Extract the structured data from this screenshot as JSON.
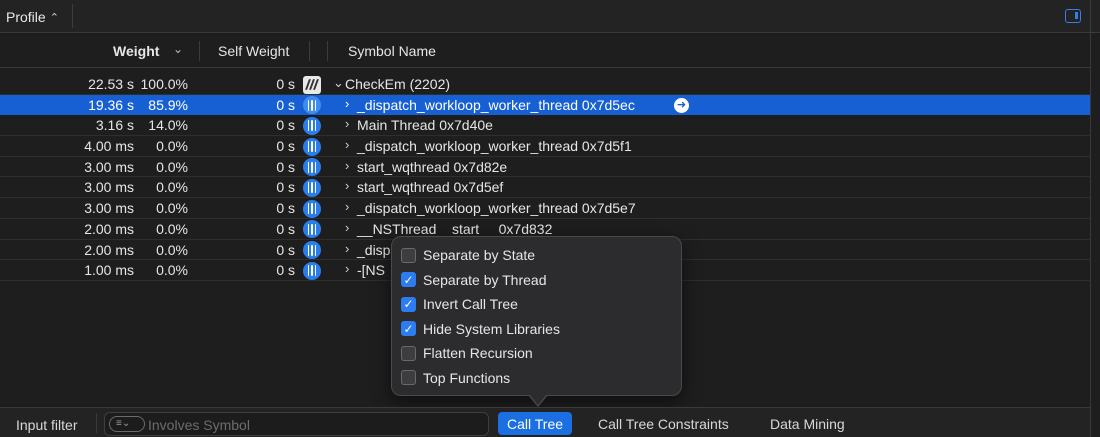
{
  "toolbar": {
    "profile_label": "Profile",
    "profile_chevron": "⌃⌄"
  },
  "columns": {
    "weight": "Weight",
    "self_weight": "Self Weight",
    "symbol_name": "Symbol Name"
  },
  "rows": [
    {
      "weight": "22.53 s",
      "pct": "100.0%",
      "self": "0 s",
      "symbol": "CheckEm (2202)",
      "expanded": true,
      "selected": false
    },
    {
      "weight": "19.36 s",
      "pct": "85.9%",
      "self": "0 s",
      "symbol": "_dispatch_workloop_worker_thread  0x7d5ec",
      "expanded": false,
      "selected": true
    },
    {
      "weight": "3.16 s",
      "pct": "14.0%",
      "self": "0 s",
      "symbol": "Main Thread  0x7d40e",
      "expanded": false,
      "selected": false
    },
    {
      "weight": "4.00 ms",
      "pct": "0.0%",
      "self": "0 s",
      "symbol": "_dispatch_workloop_worker_thread  0x7d5f1",
      "expanded": false,
      "selected": false
    },
    {
      "weight": "3.00 ms",
      "pct": "0.0%",
      "self": "0 s",
      "symbol": "start_wqthread  0x7d82e",
      "expanded": false,
      "selected": false
    },
    {
      "weight": "3.00 ms",
      "pct": "0.0%",
      "self": "0 s",
      "symbol": "start_wqthread  0x7d5ef",
      "expanded": false,
      "selected": false
    },
    {
      "weight": "3.00 ms",
      "pct": "0.0%",
      "self": "0 s",
      "symbol": "_dispatch_workloop_worker_thread  0x7d5e7",
      "expanded": false,
      "selected": false
    },
    {
      "weight": "2.00 ms",
      "pct": "0.0%",
      "self": "0 s",
      "symbol": "__NSThread__start__  0x7d832",
      "expanded": false,
      "selected": false
    },
    {
      "weight": "2.00 ms",
      "pct": "0.0%",
      "self": "0 s",
      "symbol": "_disp",
      "expanded": false,
      "selected": false
    },
    {
      "weight": "1.00 ms",
      "pct": "0.0%",
      "self": "0 s",
      "symbol": "-[NS",
      "expanded": false,
      "selected": false
    }
  ],
  "popover": {
    "options": [
      {
        "label": "Separate by State",
        "checked": false
      },
      {
        "label": "Separate by Thread",
        "checked": true
      },
      {
        "label": "Invert Call Tree",
        "checked": true
      },
      {
        "label": "Hide System Libraries",
        "checked": true
      },
      {
        "label": "Flatten Recursion",
        "checked": false
      },
      {
        "label": "Top Functions",
        "checked": false
      }
    ]
  },
  "bottom": {
    "input_filter_label": "Input filter",
    "filter_placeholder": "Involves Symbol",
    "tabs": [
      "Call Tree",
      "Call Tree Constraints",
      "Data Mining"
    ],
    "active_tab": "Call Tree"
  },
  "colors": {
    "accent": "#1760d4",
    "checkbox_on": "#2d7cf2",
    "background": "#1e1e1e"
  },
  "icons": {
    "profile_chevron": "chevron-updown-icon",
    "sort": "chevron-down-icon",
    "thread": "thread-icon",
    "process": "process-icon",
    "navigate": "arrow-right-circle-icon",
    "filter": "filter-icon",
    "panel": "sidebar-panel-icon"
  }
}
